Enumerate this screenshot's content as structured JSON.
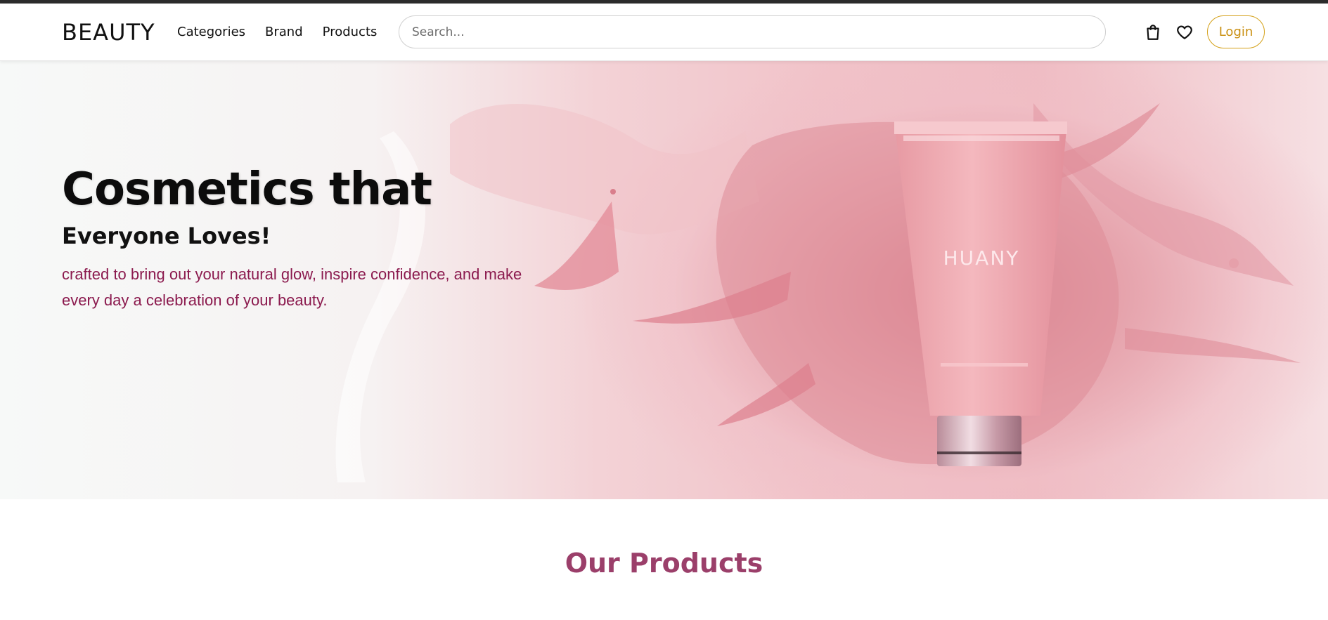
{
  "header": {
    "logo": "BEAUTY",
    "nav": [
      {
        "label": "Categories"
      },
      {
        "label": "Brand"
      },
      {
        "label": "Products"
      }
    ],
    "search": {
      "placeholder": "Search...",
      "value": ""
    },
    "icons": {
      "cart": "shopping-bag-icon",
      "wishlist": "heart-icon"
    },
    "login_label": "Login"
  },
  "hero": {
    "title": "Cosmetics that",
    "subtitle": "Everyone Loves!",
    "description": "crafted to bring out your natural glow, inspire confidence, and make every day a celebration of your beauty.",
    "product_label": "HUANY"
  },
  "section": {
    "title": "Our Products"
  },
  "colors": {
    "accent": "#d4a017",
    "description_text": "#8b1a4e",
    "section_title": "#9b3f6a",
    "hero_pink": "#e6a4ad"
  }
}
